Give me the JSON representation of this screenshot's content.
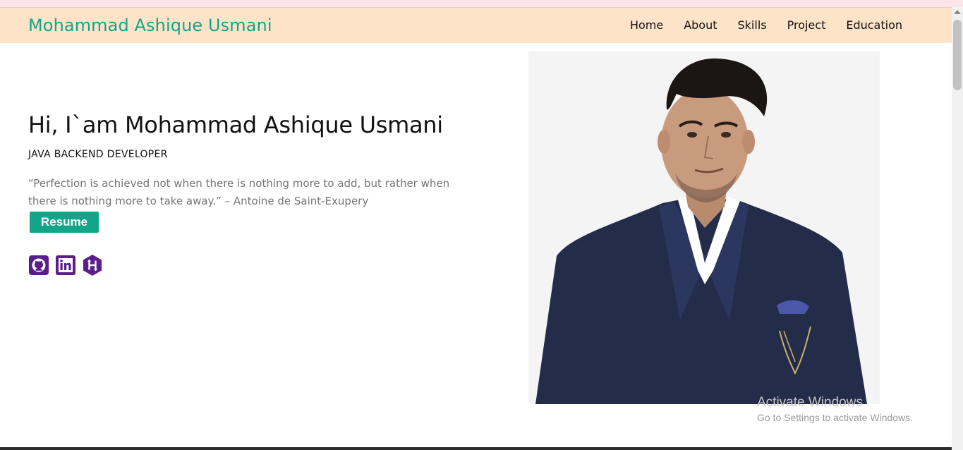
{
  "header": {
    "brand": "Mohammad Ashique Usmani",
    "nav": [
      "Home",
      "About",
      "Skills",
      "Project",
      "Education"
    ]
  },
  "hero": {
    "title": "Hi, I`am Mohammad Ashique Usmani",
    "role": "JAVA BACKEND DEVELOPER",
    "quote": "“Perfection is achieved not when there is nothing more to add, but rather when there is nothing more to take away.” – Antoine de Saint-Exupery",
    "resume_label": "Resume",
    "socials": [
      "github-icon",
      "linkedin-icon",
      "hackerrank-icon"
    ]
  },
  "watermark": {
    "title": "Activate Windows",
    "subtitle": "Go to Settings to activate Windows."
  },
  "colors": {
    "accent": "#12a58a",
    "navbar_bg": "#fde3c8",
    "social_icon": "#5a1e8c"
  }
}
